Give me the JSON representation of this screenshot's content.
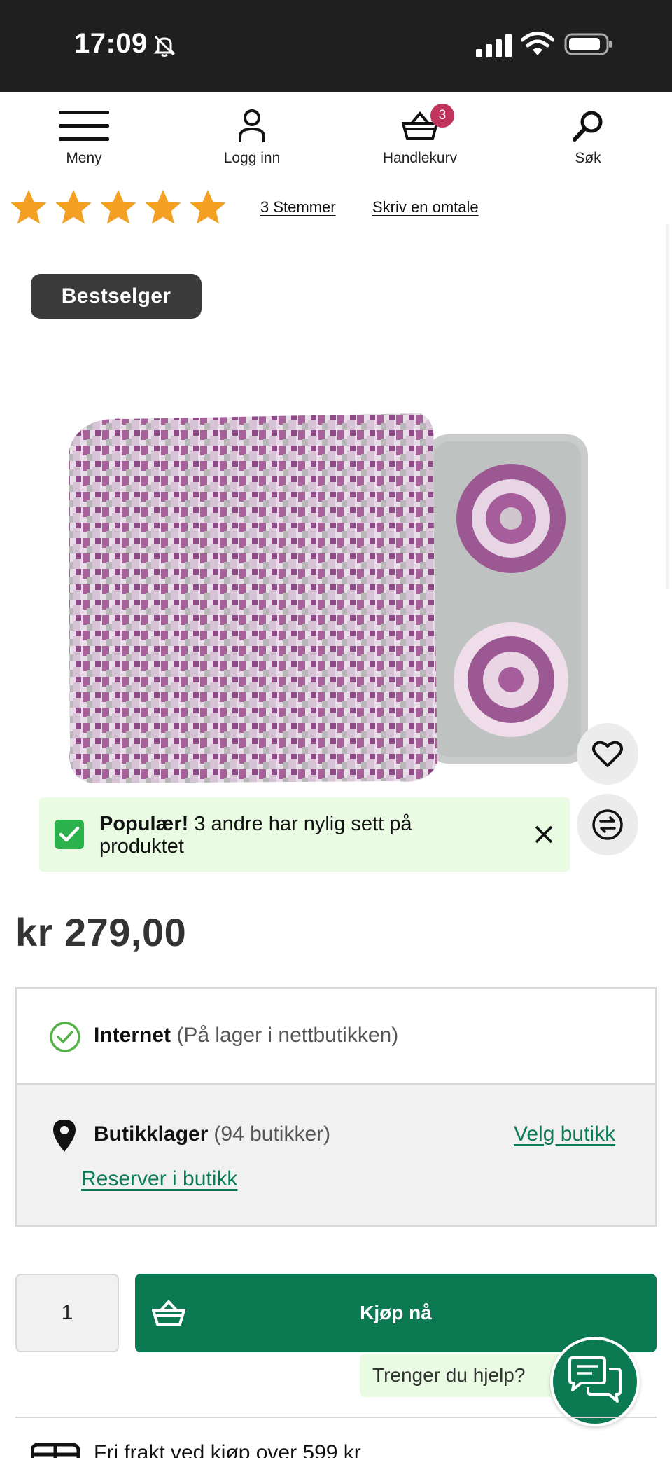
{
  "status_bar": {
    "time": "17:09",
    "icons": [
      "bell-slash-icon",
      "signal-icon",
      "wifi-icon",
      "battery-icon"
    ]
  },
  "nav": {
    "menu_label": "Meny",
    "login_label": "Logg inn",
    "cart_label": "Handlekurv",
    "cart_count": "3",
    "search_label": "Søk"
  },
  "rating": {
    "stars": 5,
    "star_color": "#f3a023",
    "votes_label": "3 Stemmer",
    "review_label": "Skriv en omtale"
  },
  "product": {
    "badge": "Bestselger",
    "image_alt": "snuffle-mat-image",
    "price": "kr 279,00"
  },
  "popular": {
    "strong": "Populær!",
    "text": " 3 andre har nylig sett på produktet"
  },
  "stock": {
    "internet_label": "Internet",
    "internet_detail": "(På lager i nettbutikken)",
    "shop_label": "Butikklager",
    "shop_detail": "(94 butikker)",
    "choose_shop": "Velg butikk",
    "reserve": "Reserver i butikk"
  },
  "purchase": {
    "quantity": "1",
    "buy_label": "Kjøp nå"
  },
  "help": {
    "text": "Trenger du hjelp?"
  },
  "shipping": {
    "text": "Fri frakt ved kjøp over 599 kr"
  },
  "colors": {
    "accent_green": "#0b7a52",
    "badge_pink": "#c0335d",
    "banner_green": "#e9fbe2"
  }
}
